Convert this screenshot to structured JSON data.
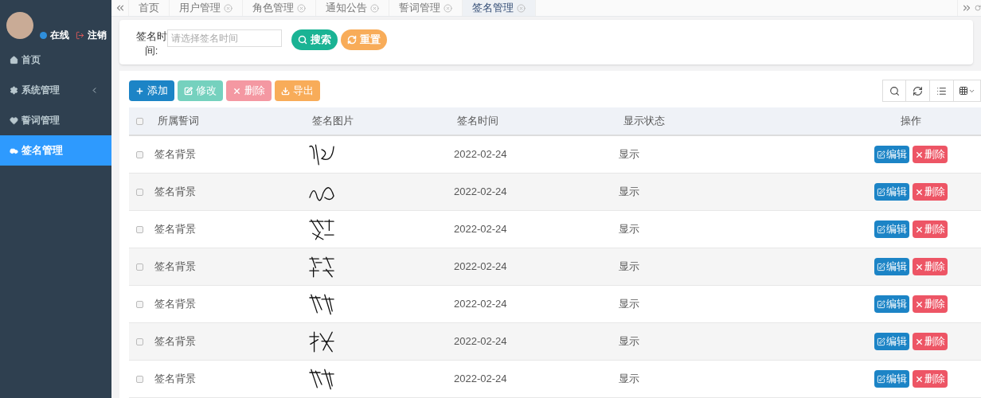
{
  "user": {
    "status": "在线",
    "logout": "注销"
  },
  "sidebar": {
    "items": [
      {
        "label": "首页",
        "has_children": false,
        "selected": false
      },
      {
        "label": "系统管理",
        "has_children": true,
        "selected": false
      },
      {
        "label": "誓词管理",
        "has_children": false,
        "selected": false
      },
      {
        "label": "签名管理",
        "has_children": false,
        "selected": true
      }
    ]
  },
  "tabs": [
    {
      "label": "首页",
      "closable": false,
      "selected": false
    },
    {
      "label": "用户管理",
      "closable": true,
      "selected": false
    },
    {
      "label": "角色管理",
      "closable": true,
      "selected": false
    },
    {
      "label": "通知公告",
      "closable": true,
      "selected": false
    },
    {
      "label": "誓词管理",
      "closable": true,
      "selected": false
    },
    {
      "label": "签名管理",
      "closable": true,
      "selected": true
    }
  ],
  "search": {
    "label": "签名时间:",
    "placeholder": "请选择签名时间",
    "buttons": [
      {
        "label": "搜索",
        "kind": "search"
      },
      {
        "label": "重置",
        "kind": "reset"
      }
    ]
  },
  "toolbar": [
    {
      "label": "添加",
      "kind": "add",
      "disabled": false
    },
    {
      "label": "修改",
      "kind": "edit",
      "disabled": true
    },
    {
      "label": "删除",
      "kind": "delete",
      "disabled": true
    },
    {
      "label": "导出",
      "kind": "export",
      "disabled": false
    }
  ],
  "table": {
    "all_checked": false,
    "columns": [
      "所属誓词",
      "签名图片",
      "签名时间",
      "显示状态",
      "操作"
    ],
    "rows": [
      {
        "checked": false,
        "oath": "签名背景",
        "time": "2022-02-24",
        "status": "显示",
        "actions": [
          "编辑",
          "删除"
        ]
      },
      {
        "checked": false,
        "oath": "签名背景",
        "time": "2022-02-24",
        "status": "显示",
        "actions": [
          "编辑",
          "删除"
        ]
      },
      {
        "checked": false,
        "oath": "签名背景",
        "time": "2022-02-24",
        "status": "显示",
        "actions": [
          "编辑",
          "删除"
        ]
      },
      {
        "checked": false,
        "oath": "签名背景",
        "time": "2022-02-24",
        "status": "显示",
        "actions": [
          "编辑",
          "删除"
        ]
      },
      {
        "checked": false,
        "oath": "签名背景",
        "time": "2022-02-24",
        "status": "显示",
        "actions": [
          "编辑",
          "删除"
        ]
      },
      {
        "checked": false,
        "oath": "签名背景",
        "time": "2022-02-24",
        "status": "显示",
        "actions": [
          "编辑",
          "删除"
        ]
      },
      {
        "checked": false,
        "oath": "签名背景",
        "time": "2022-02-24",
        "status": "显示",
        "actions": [
          "编辑",
          "删除"
        ]
      }
    ]
  }
}
